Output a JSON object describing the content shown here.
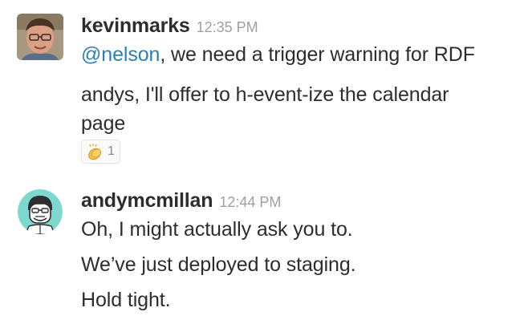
{
  "messages": [
    {
      "username": "kevinmarks",
      "timestamp": "12:35 PM",
      "avatar": "photo-avatar",
      "lines": [
        {
          "mention": "@nelson",
          "text": ", we need a trigger warning for RDF"
        },
        {
          "text": "andys, I'll offer to h-event-ize the calendar page"
        }
      ],
      "reaction": {
        "emoji": "clapping-hands-icon",
        "count": "1"
      }
    },
    {
      "username": "andymcmillan",
      "timestamp": "12:44 PM",
      "avatar": "illustrated-avatar",
      "lines": [
        {
          "text": "Oh, I might actually ask you to."
        },
        {
          "text": "We’ve just deployed to staging."
        },
        {
          "text": "Hold tight."
        }
      ]
    }
  ],
  "colors": {
    "mention": "#2a80b9",
    "timestamp": "#a0a0a2",
    "text": "#2c2d30",
    "avatar_circle": "#7dd9cf"
  }
}
